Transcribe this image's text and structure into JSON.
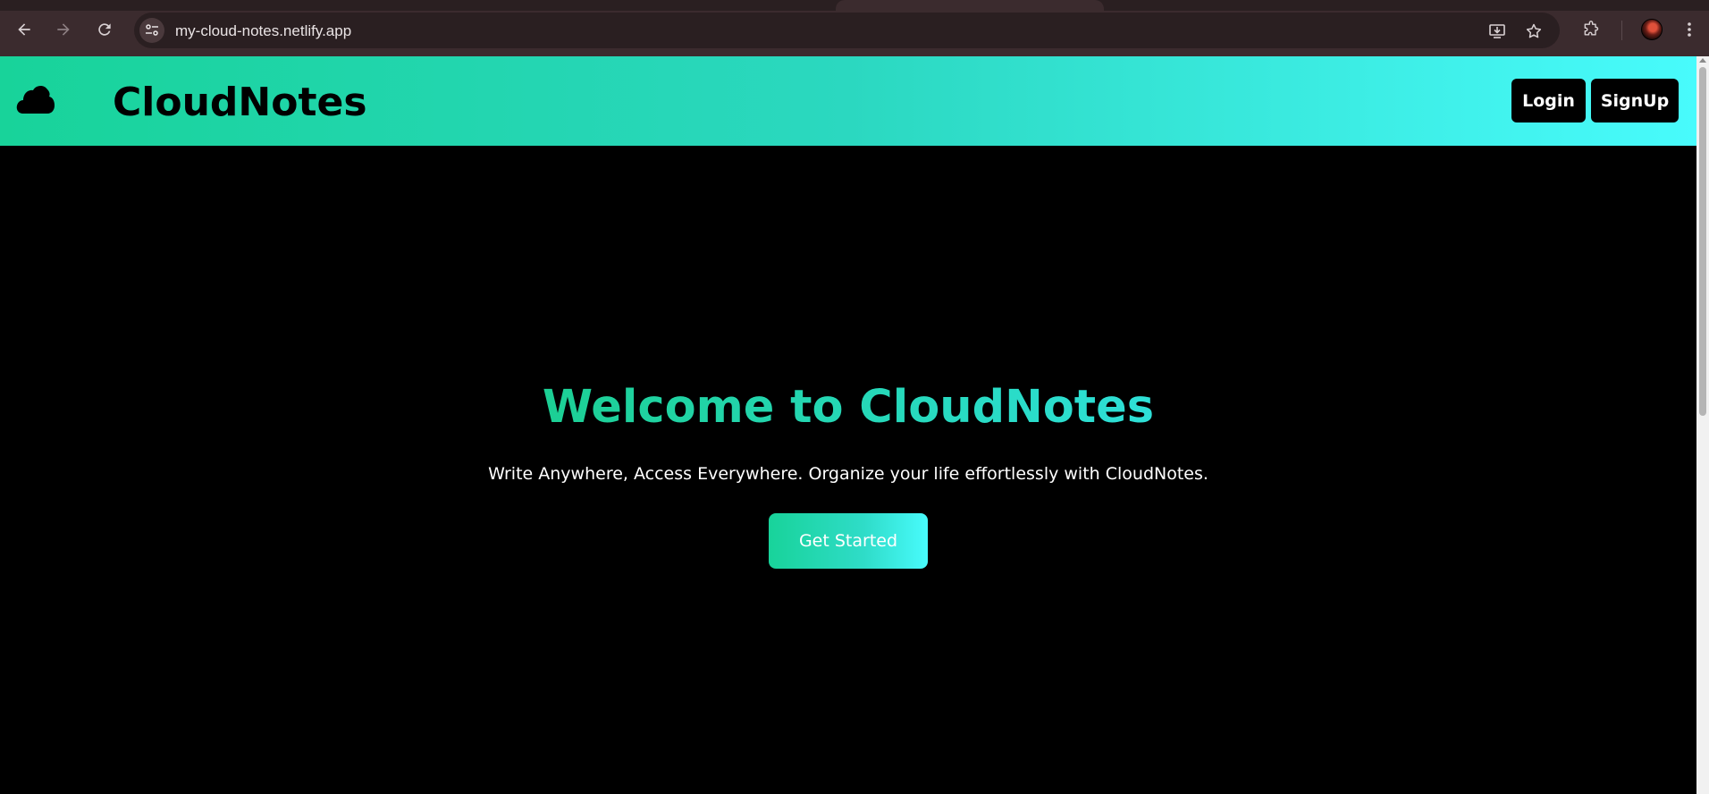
{
  "browser": {
    "url": "my-cloud-notes.netlify.app",
    "icons": {
      "back": "arrow-left-icon",
      "forward": "arrow-right-icon",
      "reload": "reload-icon",
      "site_info": "tune-icon",
      "install": "install-app-icon",
      "bookmark": "star-icon",
      "extensions": "puzzle-icon",
      "profile": "avatar",
      "menu": "kebab-menu-icon"
    }
  },
  "navbar": {
    "brand": "CloudNotes",
    "logo_icon": "cloud-icon",
    "login_label": "Login",
    "signup_label": "SignUp",
    "gradient_start": "#18d39a",
    "gradient_end": "#48fbfc"
  },
  "hero": {
    "title": "Welcome to CloudNotes",
    "subtitle": "Write Anywhere, Access Everywhere. Organize your life effortlessly with CloudNotes.",
    "cta_label": "Get Started",
    "title_color": "#1ed2a0"
  },
  "colors": {
    "background": "#000000",
    "browser_chrome": "#3b2b2e",
    "button_dark": "#000000"
  }
}
